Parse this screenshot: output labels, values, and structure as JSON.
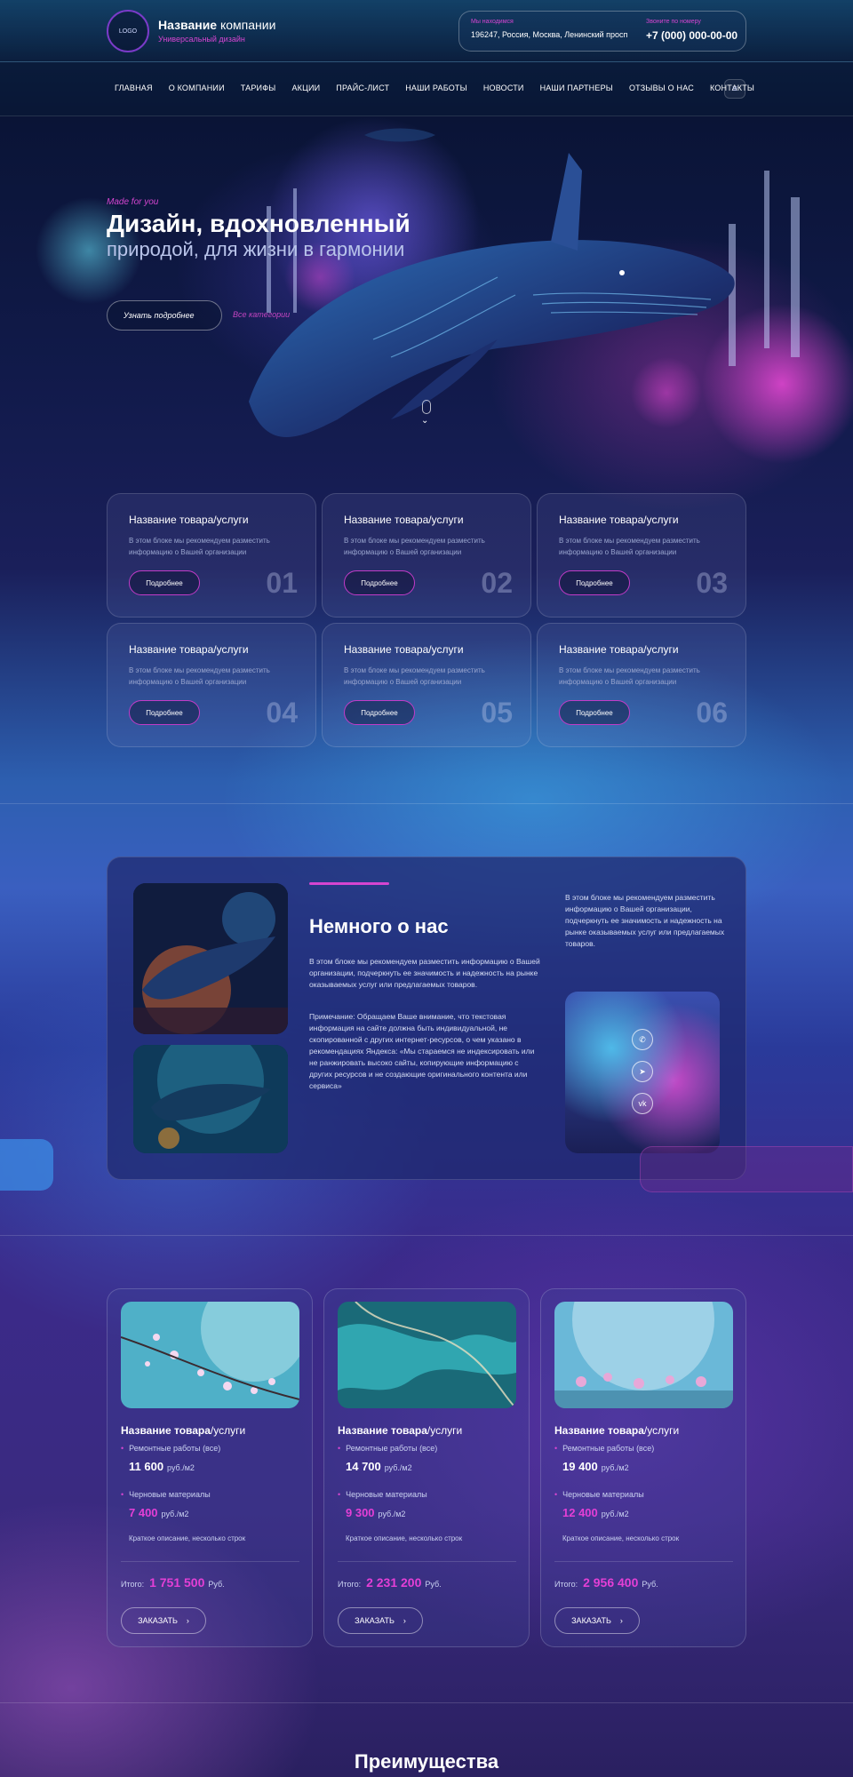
{
  "header": {
    "logo": "LOGO",
    "company_bold": "Название",
    "company_rest": " компании",
    "tagline": "Универсальный дизайн",
    "address_label": "Мы находимся",
    "address": "196247, Россия, Москва, Ленинский просп",
    "phone_label": "Звоните по номеру",
    "phone": "+7 (000) 000-00-00"
  },
  "nav": {
    "items": [
      "ГЛАВНАЯ",
      "О КОМПАНИИ",
      "ТАРИФЫ",
      "АКЦИИ",
      "ПРАЙС-ЛИСТ",
      "НАШИ РАБОТЫ",
      "НОВОСТИ",
      "НАШИ ПАРТНЕРЫ",
      "ОТЗЫВЫ О НАС",
      "КОНТАКТЫ"
    ],
    "menu_icon": "≡"
  },
  "hero": {
    "eyebrow": "Made for you",
    "title": "Дизайн, вдохновленный",
    "subtitle": "природой, для жизни в гармонии",
    "button": "Узнать подробнее",
    "link": "Все категории"
  },
  "services": [
    {
      "title": "Название товара/услуги",
      "desc": "В этом блоке мы рекомендуем разместить информацию о Вашей организации",
      "button": "Подробнее",
      "num": "01"
    },
    {
      "title": "Название товара/услуги",
      "desc": "В этом блоке мы рекомендуем разместить информацию о Вашей организации",
      "button": "Подробнее",
      "num": "02"
    },
    {
      "title": "Название товара/услуги",
      "desc": "В этом блоке мы рекомендуем разместить информацию о Вашей организации",
      "button": "Подробнее",
      "num": "03"
    },
    {
      "title": "Название товара/услуги",
      "desc": "В этом блоке мы рекомендуем разместить информацию о Вашей организации",
      "button": "Подробнее",
      "num": "04"
    },
    {
      "title": "Название товара/услуги",
      "desc": "В этом блоке мы рекомендуем разместить информацию о Вашей организации",
      "button": "Подробнее",
      "num": "05"
    },
    {
      "title": "Название товара/услуги",
      "desc": "В этом блоке мы рекомендуем разместить информацию о Вашей организации",
      "button": "Подробнее",
      "num": "06"
    }
  ],
  "about": {
    "title": "Немного о нас",
    "text": "В этом блоке мы рекомендуем разместить информацию о Вашей организации, подчеркнуть ее значимость и надежность на рынке оказываемых услуг или предлагаемых товаров.",
    "note": "Примечание: Обращаем Ваше внимание, что текстовая информация на сайте должна быть индивидуальной, не скопированной с других интернет-ресурсов, о чем указано в рекомендациях Яндекса: «Мы стараемся не индексировать или не ранжировать высоко сайты, копирующие информацию с других ресурсов и не создающие оригинального контента или сервиса»",
    "side_text": "В этом блоке мы рекомендуем разместить информацию о Вашей организации, подчеркнуть ее значимость и надежность на рынке оказываемых услуг или предлагаемых товаров.",
    "socials": [
      "whatsapp-icon",
      "telegram-icon",
      "vk-icon"
    ]
  },
  "prices": [
    {
      "title_bold": "Название товара",
      "title_rest": "/услуги",
      "line1": "Ремонтные работы (все)",
      "value1": "11 600",
      "unit1": "руб./м2",
      "line2": "Черновые материалы",
      "value2": "7 400",
      "unit2": "руб./м2",
      "desc": "Краткое описание, несколько строк",
      "total_label": "Итого:",
      "total": "1 751 500",
      "currency": "Руб.",
      "button": "ЗАКАЗАТЬ"
    },
    {
      "title_bold": "Название товара",
      "title_rest": "/услуги",
      "line1": "Ремонтные работы (все)",
      "value1": "14 700",
      "unit1": "руб./м2",
      "line2": "Черновые материалы",
      "value2": "9 300",
      "unit2": "руб./м2",
      "desc": "Краткое описание, несколько строк",
      "total_label": "Итого:",
      "total": "2 231 200",
      "currency": "Руб.",
      "button": "ЗАКАЗАТЬ"
    },
    {
      "title_bold": "Название товара",
      "title_rest": "/услуги",
      "line1": "Ремонтные работы (все)",
      "value1": "19 400",
      "unit1": "руб./м2",
      "line2": "Черновые материалы",
      "value2": "12 400",
      "unit2": "руб./м2",
      "desc": "Краткое описание, несколько строк",
      "total_label": "Итого:",
      "total": "2 956 400",
      "currency": "Руб.",
      "button": "ЗАКАЗАТЬ"
    }
  ],
  "advantages": {
    "title": "Преимущества"
  },
  "colors": {
    "accent": "#d545d0",
    "price_accent": "#e43fd6"
  }
}
